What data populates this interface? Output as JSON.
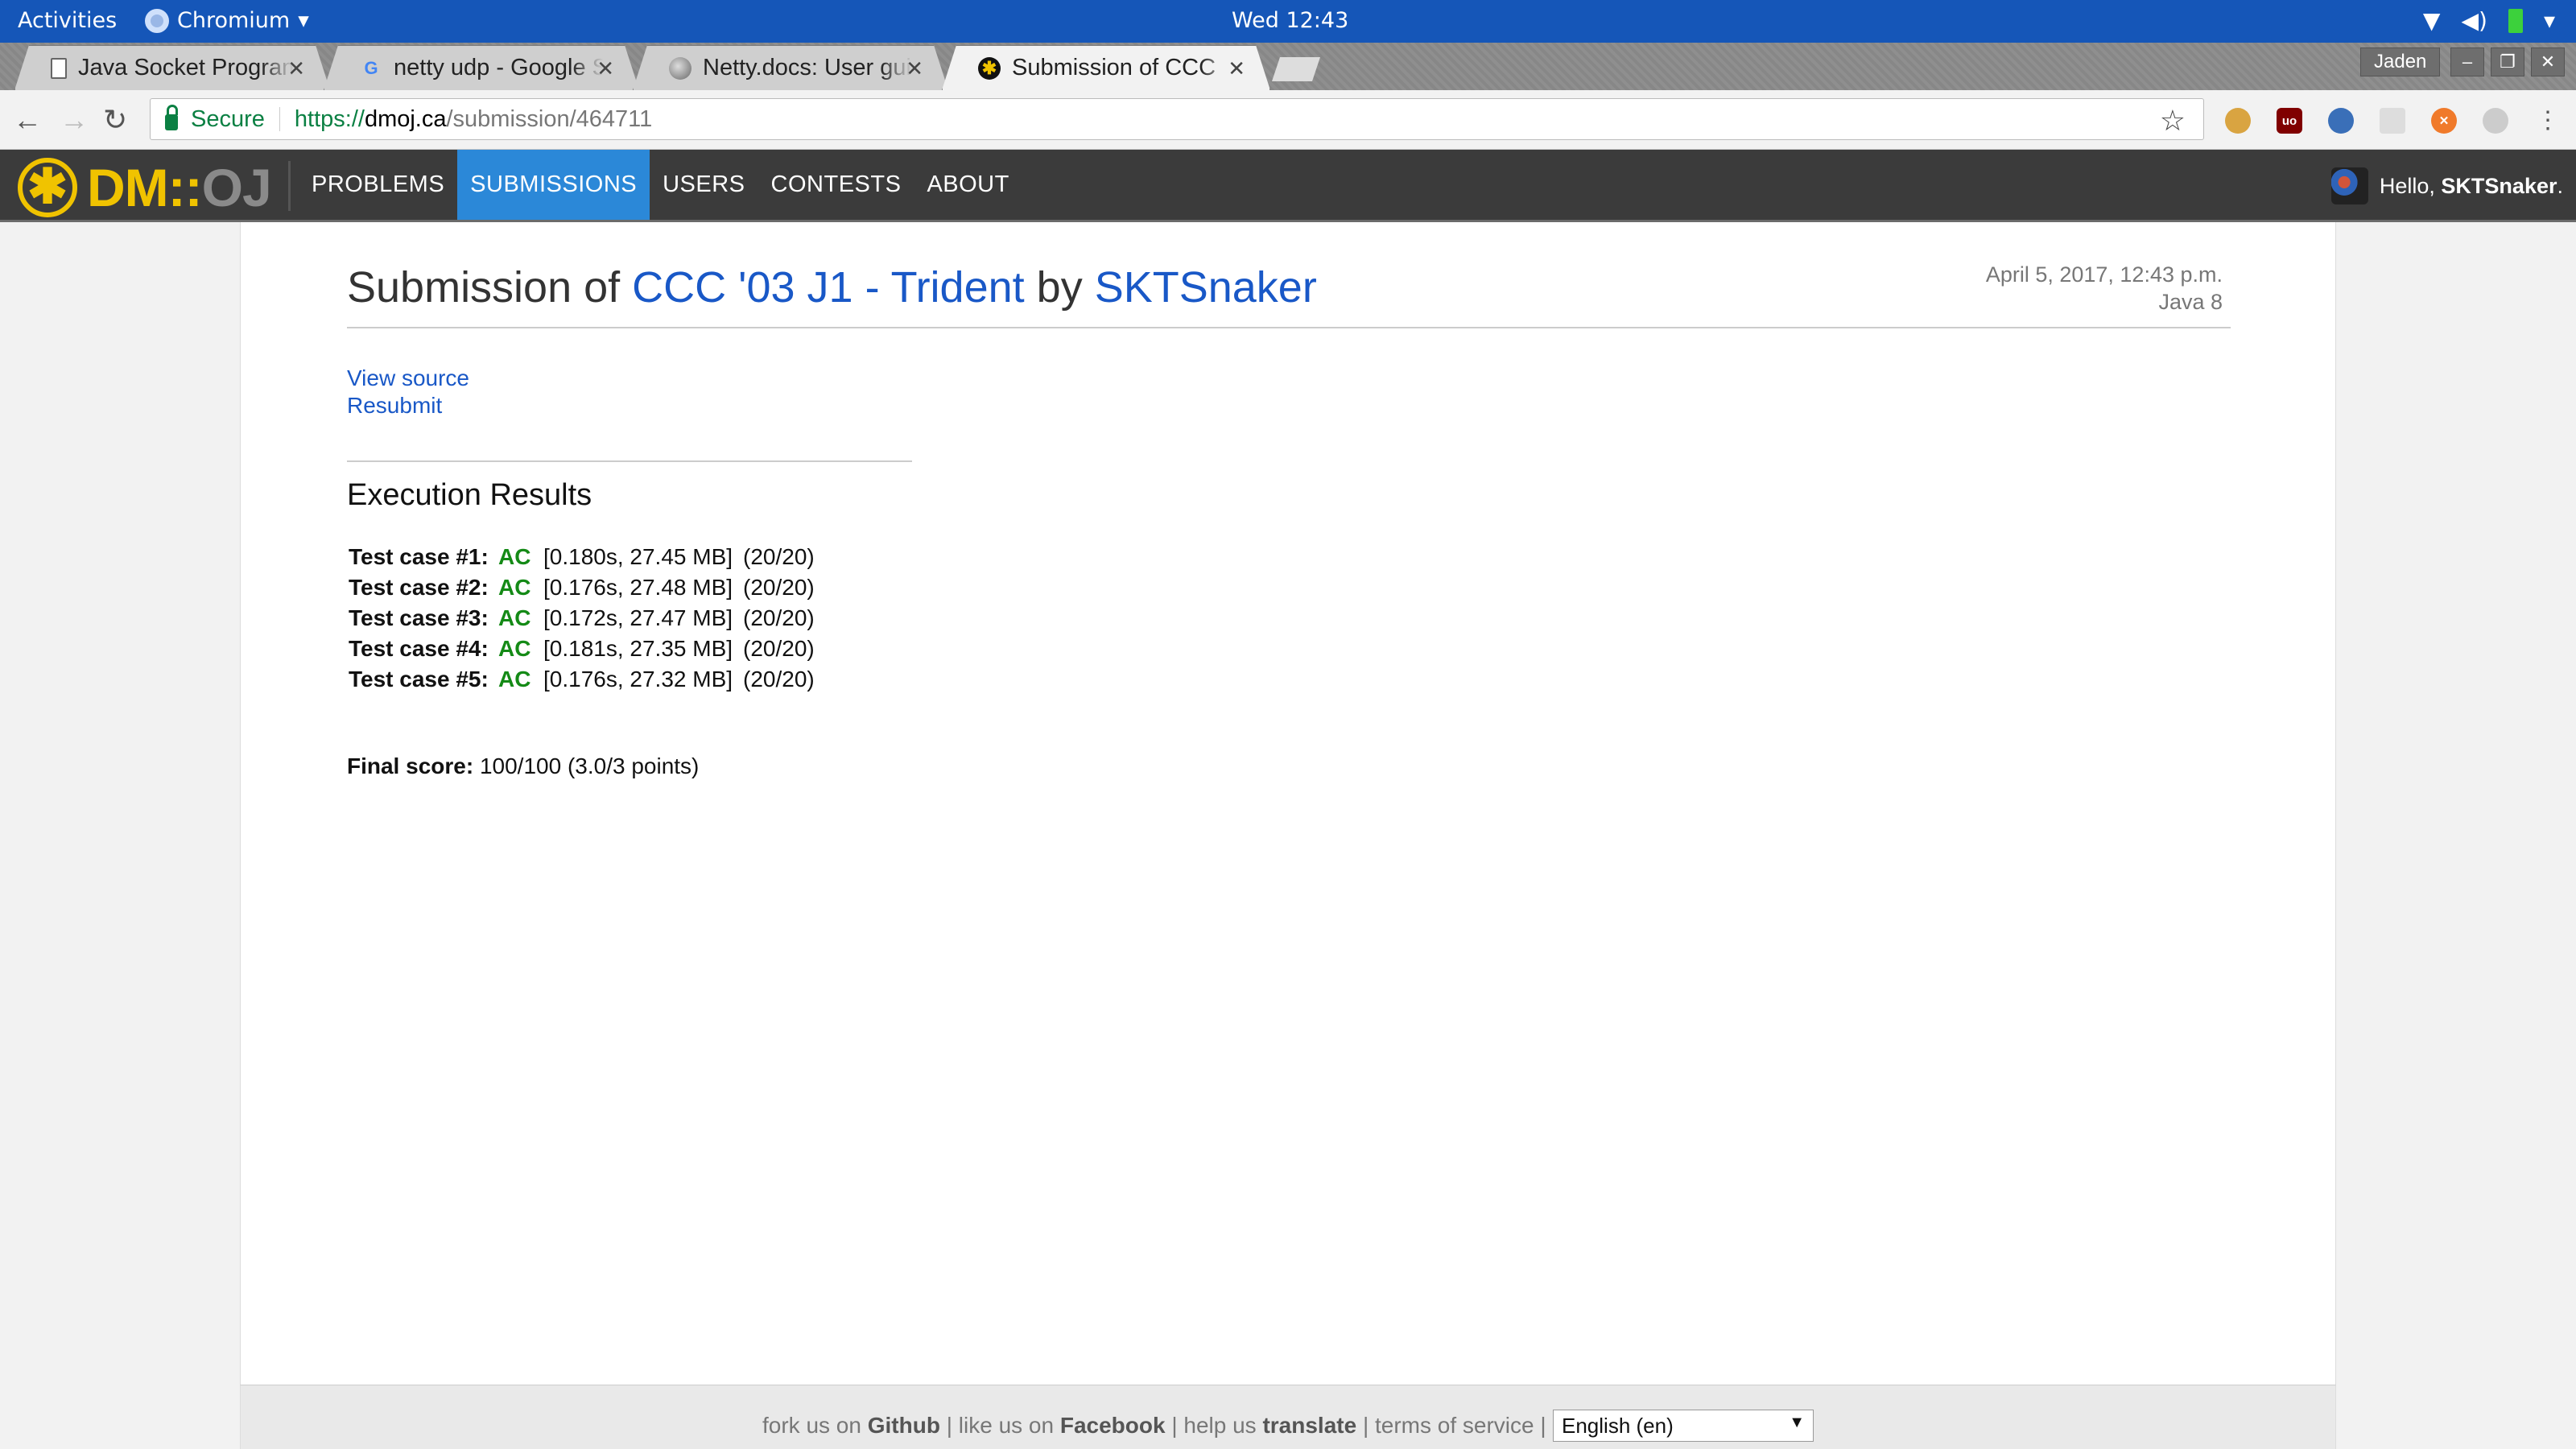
{
  "gnome": {
    "activities": "Activities",
    "app_name": "Chromium",
    "clock": "Wed 12:43"
  },
  "tabs": [
    {
      "title": "Java Socket Programming",
      "favicon": "document-icon"
    },
    {
      "title": "netty udp - Google Search",
      "favicon": "google-icon"
    },
    {
      "title": "Netty.docs: User guide",
      "favicon": "netty-icon"
    },
    {
      "title": "Submission of CCC",
      "favicon": "dmoj-icon",
      "active": true
    }
  ],
  "window": {
    "profile": "Jaden"
  },
  "omnibox": {
    "secure_label": "Secure",
    "url_scheme": "https://",
    "url_host": "dmoj.ca",
    "url_path": "/submission/464711"
  },
  "site": {
    "logo_dm": "DM::",
    "logo_oj": "OJ",
    "nav": [
      "PROBLEMS",
      "SUBMISSIONS",
      "USERS",
      "CONTESTS",
      "ABOUT"
    ],
    "active_nav": "SUBMISSIONS",
    "greeting": "Hello, ",
    "username": "SKTSnaker",
    "greeting_suffix": "."
  },
  "submission": {
    "title_prefix": "Submission of ",
    "problem": "CCC '03 J1 - Trident",
    "by": " by ",
    "user": "SKTSnaker",
    "date": "April 5, 2017, 12:43 p.m.",
    "language": "Java 8",
    "view_source": "View source",
    "resubmit": "Resubmit",
    "results_heading": "Execution Results",
    "cases": [
      {
        "label": "Test case #1:",
        "status": "AC",
        "detail": "[0.180s, 27.45 MB]",
        "points": "(20/20)"
      },
      {
        "label": "Test case #2:",
        "status": "AC",
        "detail": "[0.176s, 27.48 MB]",
        "points": "(20/20)"
      },
      {
        "label": "Test case #3:",
        "status": "AC",
        "detail": "[0.172s, 27.47 MB]",
        "points": "(20/20)"
      },
      {
        "label": "Test case #4:",
        "status": "AC",
        "detail": "[0.181s, 27.35 MB]",
        "points": "(20/20)"
      },
      {
        "label": "Test case #5:",
        "status": "AC",
        "detail": "[0.176s, 27.32 MB]",
        "points": "(20/20)"
      }
    ],
    "final_label": "Final score:",
    "final_value": " 100/100 (3.0/3 points)"
  },
  "footer": {
    "fork_pre": "fork us on ",
    "github": "Github",
    "like_pre": " | like us on ",
    "facebook": "Facebook",
    "help_pre": " | help us ",
    "translate": "translate",
    "tos": " | terms of service | ",
    "language": "English (en)"
  },
  "colors": {
    "accent": "#2b88d8",
    "link": "#1958c7",
    "ac_green": "#148a16",
    "logo_yellow": "#f0c300"
  }
}
